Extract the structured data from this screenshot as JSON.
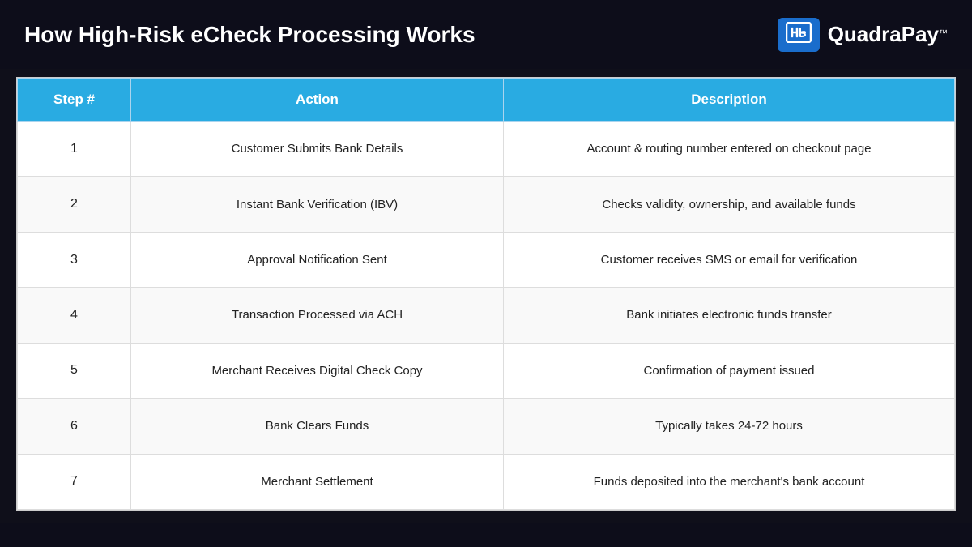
{
  "header": {
    "title": "How High-Risk eCheck Processing Works",
    "logo": {
      "symbol": "DP",
      "brand": "QuadraPay",
      "tm": "™"
    }
  },
  "table": {
    "columns": [
      {
        "id": "step",
        "label": "Step #"
      },
      {
        "id": "action",
        "label": "Action"
      },
      {
        "id": "description",
        "label": "Description"
      }
    ],
    "rows": [
      {
        "step": "1",
        "action": "Customer Submits Bank Details",
        "description": "Account & routing number entered on checkout page"
      },
      {
        "step": "2",
        "action": "Instant Bank Verification (IBV)",
        "description": "Checks validity, ownership, and available funds"
      },
      {
        "step": "3",
        "action": "Approval Notification Sent",
        "description": "Customer receives SMS or email for verification"
      },
      {
        "step": "4",
        "action": "Transaction Processed via ACH",
        "description": "Bank initiates electronic funds transfer"
      },
      {
        "step": "5",
        "action": "Merchant Receives Digital Check Copy",
        "description": "Confirmation of payment issued"
      },
      {
        "step": "6",
        "action": "Bank Clears Funds",
        "description": "Typically takes 24-72 hours"
      },
      {
        "step": "7",
        "action": "Merchant Settlement",
        "description": "Funds deposited into the merchant's bank account"
      }
    ]
  }
}
